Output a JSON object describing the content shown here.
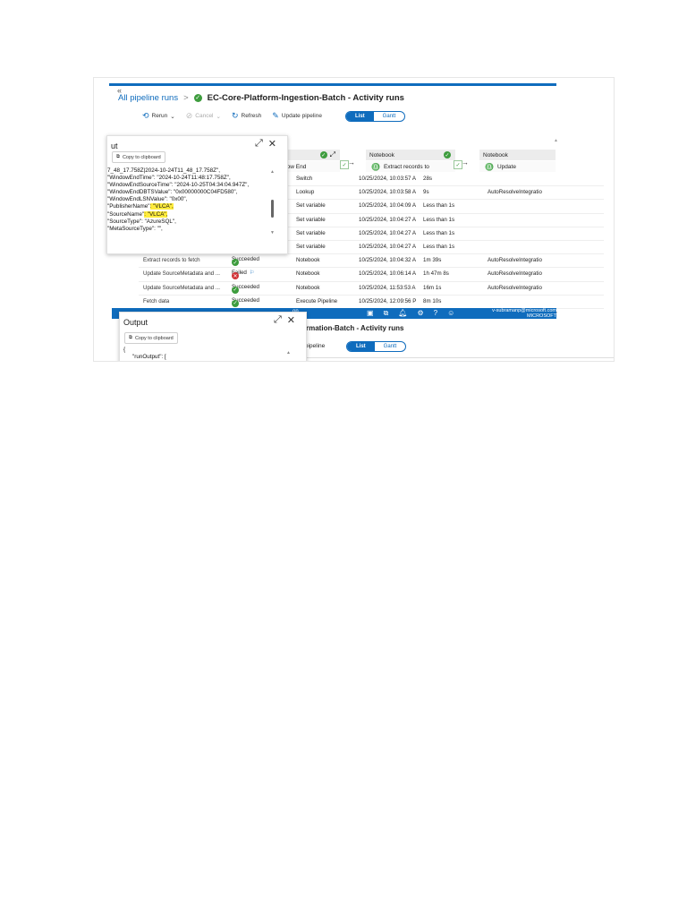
{
  "header": {
    "breadcrumb_link": "All pipeline runs",
    "separator": ">",
    "run_title": "EC-Core-Platform-Ingestion-Batch - Activity runs",
    "chevrons": "«"
  },
  "toolbar": {
    "rerun": "Rerun",
    "cancel": "Cancel",
    "refresh": "Refresh",
    "update_pipeline": "Update pipeline",
    "view_list": "List",
    "view_gantt": "Gantt"
  },
  "pipeline_nodes": {
    "partial_left": "h",
    "partial_sub": "indow End",
    "notebook1_title": "Notebook",
    "notebook1_sub": "Extract records to",
    "notebook2_title": "Notebook",
    "notebook2_sub": "Update"
  },
  "activity_rows": [
    {
      "name": "",
      "status": "",
      "type": "Switch",
      "start": "10/25/2024, 10:03:57 A",
      "duration": "28s",
      "ir": ""
    },
    {
      "name": "",
      "status": "",
      "type": "Lookup",
      "start": "10/25/2024, 10:03:58 A",
      "duration": "9s",
      "ir": "AutoResolveIntegratio"
    },
    {
      "name": "",
      "status": "",
      "type": "Set variable",
      "start": "10/25/2024, 10:04:09 A",
      "duration": "Less than 1s",
      "ir": ""
    },
    {
      "name": "",
      "status": "",
      "type": "Set variable",
      "start": "10/25/2024, 10:04:27 A",
      "duration": "Less than 1s",
      "ir": ""
    },
    {
      "name": "",
      "status": "",
      "type": "Set variable",
      "start": "10/25/2024, 10:04:27 A",
      "duration": "Less than 1s",
      "ir": ""
    },
    {
      "name": "",
      "status": "",
      "type": "Set variable",
      "start": "10/25/2024, 10:04:27 A",
      "duration": "Less than 1s",
      "ir": ""
    },
    {
      "name": "Extract records to fetch",
      "status": "Succeeded",
      "type": "Notebook",
      "start": "10/25/2024, 10:04:32 A",
      "duration": "1m 39s",
      "ir": "AutoResolveIntegratio"
    },
    {
      "name": "Update SourceMetadata and ...",
      "status": "Failed",
      "type": "Notebook",
      "start": "10/25/2024, 10:06:14 A",
      "duration": "1h 47m 8s",
      "ir": "AutoResolveIntegratio"
    },
    {
      "name": "Update SourceMetadata and ...",
      "status": "Succeeded",
      "type": "Notebook",
      "start": "10/25/2024, 11:53:53 A",
      "duration": "16m 1s",
      "ir": "AutoResolveIntegratio"
    },
    {
      "name": "Fetch data",
      "status": "Succeeded",
      "type": "Execute Pipeline",
      "start": "10/25/2024, 12:09:56 P",
      "duration": "8m 10s",
      "ir": ""
    }
  ],
  "taskbar": {
    "user_line1": "v-subramanp@microsoft.com",
    "user_line2": "MICROSOFT",
    "grid_label": "on"
  },
  "output_panel_1": {
    "title": "ut",
    "copy_label": "Copy to clipboard",
    "lines": [
      "7_48_17.758Z|2024-10-24T11_48_17.758Z\",",
      "\"WindowEndTime\": \"2024-10-24T11:48:17.758Z\",",
      "\"WindowEndSourceTime\": \"2024-10-25T04:34:04.947Z\",",
      "\"WindowEndDBTSValue\": \"0x00000000C04FD580\",",
      "\"WindowEndLSNValue\": \"0x00\",",
      "\"PublisherName\": \"VLCA\",",
      "\"SourceName\": \"VLCA\",",
      "\"SourceType\": \"AzureSQL\",",
      "\"MetaSourceType\": \"\","
    ]
  },
  "output_panel_2": {
    "title": "Output",
    "copy_label": "Copy to clipboard",
    "line1": "{",
    "line2": "\"runOutput\": ["
  },
  "bottom_window": {
    "title_fragment": "sformation-Batch - Activity runs",
    "update_fragment": "ate pipeline",
    "view_list": "List",
    "view_gantt": "Gantt"
  }
}
